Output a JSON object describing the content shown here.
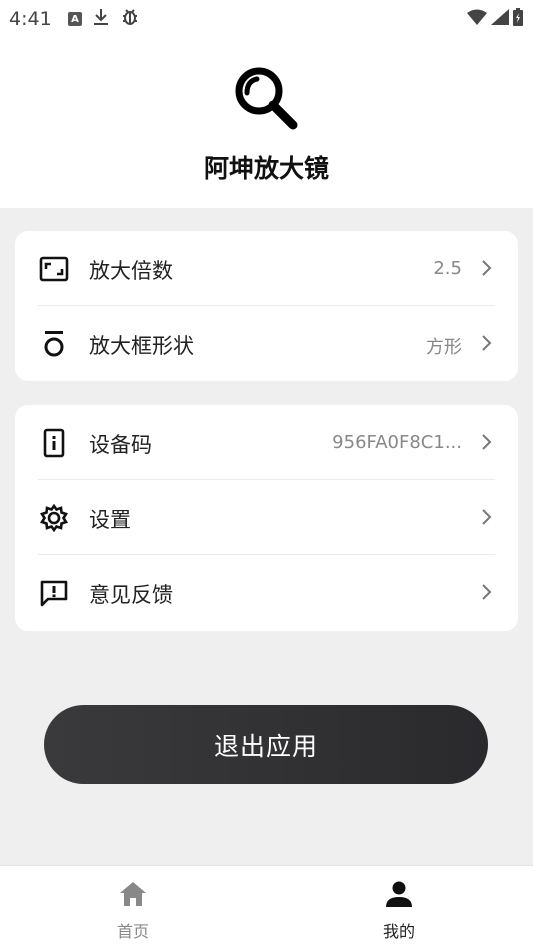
{
  "status_bar": {
    "time": "4:41",
    "left_icons": [
      "a-badge-icon",
      "download-icon",
      "bug-icon"
    ],
    "right_icons": [
      "wifi-icon",
      "signal-icon",
      "battery-charging-icon"
    ]
  },
  "header": {
    "logo_icon": "magnifier-icon",
    "app_name": "阿坤放大镜"
  },
  "settings_group_1": [
    {
      "icon": "magnification-frame-icon",
      "label": "放大倍数",
      "value": "2.5"
    },
    {
      "icon": "shape-o-icon",
      "label": "放大框形状",
      "value": "方形"
    }
  ],
  "settings_group_2": [
    {
      "icon": "device-icon",
      "label": "设备码",
      "value": "956FA0F8C1..."
    },
    {
      "icon": "gear-icon",
      "label": "设置",
      "value": ""
    },
    {
      "icon": "feedback-icon",
      "label": "意见反馈",
      "value": ""
    }
  ],
  "exit_button": {
    "label": "退出应用"
  },
  "bottom_nav": {
    "items": [
      {
        "label": "首页",
        "icon": "home-icon",
        "active": false
      },
      {
        "label": "我的",
        "icon": "person-icon",
        "active": true
      }
    ]
  },
  "colors": {
    "background": "#efefef",
    "card": "#ffffff",
    "button": "#2f2f32",
    "active_nav": "#222222",
    "inactive_nav": "#888888"
  }
}
